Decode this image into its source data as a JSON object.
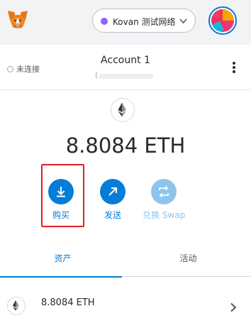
{
  "header": {
    "network_label": "Kovan 测试网络",
    "network_color": "#9064ff"
  },
  "account": {
    "connection_status": "未连接",
    "name": "Account 1",
    "address_prefix": "("
  },
  "balance": {
    "text": "8.8084 ETH"
  },
  "actions": [
    {
      "label": "购买",
      "icon": "download-icon",
      "enabled": true
    },
    {
      "label": "发送",
      "icon": "arrow-up-right-icon",
      "enabled": true
    },
    {
      "label": "兑换 Swap",
      "icon": "swap-icon",
      "enabled": false
    }
  ],
  "tabs": [
    {
      "label": "资产",
      "active": true
    },
    {
      "label": "活动",
      "active": false
    }
  ],
  "assets": [
    {
      "name": "8.8084 ETH",
      "icon": "ethereum-icon"
    }
  ],
  "colors": {
    "accent": "#037dd6",
    "highlight_box": "#e02020"
  }
}
